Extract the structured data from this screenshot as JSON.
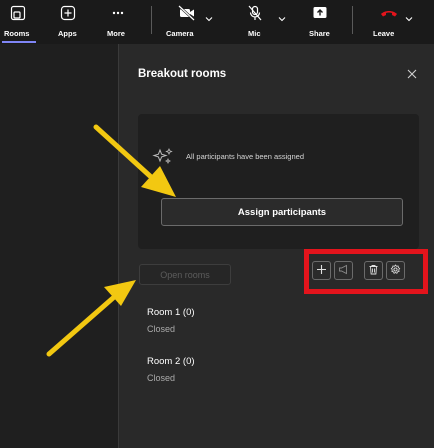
{
  "toolbar": {
    "rooms_label": "Rooms",
    "apps_label": "Apps",
    "more_label": "More",
    "camera_label": "Camera",
    "mic_label": "Mic",
    "share_label": "Share",
    "leave_label": "Leave"
  },
  "panel": {
    "title": "Breakout rooms",
    "status_text": "All participants have been assigned",
    "assign_label": "Assign participants",
    "open_rooms_label": "Open rooms"
  },
  "rooms": [
    {
      "name": "Room 1 (0)",
      "status": "Closed"
    },
    {
      "name": "Room 2 (0)",
      "status": "Closed"
    }
  ],
  "colors": {
    "accent": "#7f85f5",
    "leave": "#e3141c",
    "annotation_box": "#e3141c",
    "annotation_arrow": "#f2c811"
  }
}
